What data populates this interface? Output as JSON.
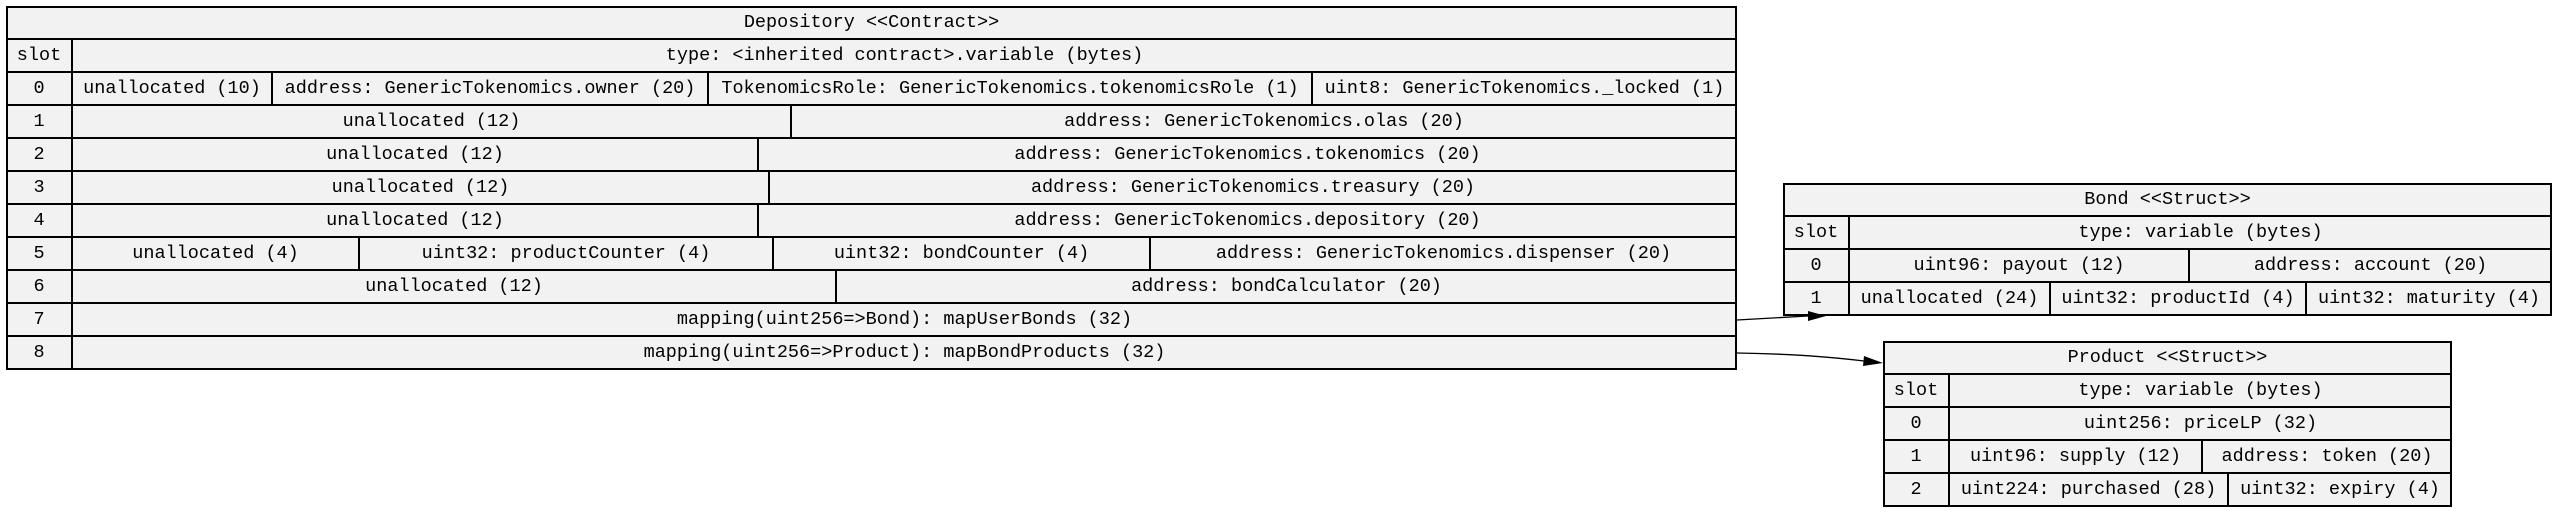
{
  "depository": {
    "title": "Depository <<Contract>>",
    "header": {
      "slot": "slot",
      "type": "type: <inherited contract>.variable (bytes)"
    },
    "rows": [
      {
        "slot": "0",
        "cells": [
          "unallocated (10)",
          "address: GenericTokenomics.owner (20)",
          "TokenomicsRole: GenericTokenomics.tokenomicsRole (1)",
          "uint8: GenericTokenomics._locked (1)"
        ]
      },
      {
        "slot": "1",
        "cells": [
          "unallocated (12)",
          "address: GenericTokenomics.olas (20)"
        ]
      },
      {
        "slot": "2",
        "cells": [
          "unallocated (12)",
          "address: GenericTokenomics.tokenomics (20)"
        ]
      },
      {
        "slot": "3",
        "cells": [
          "unallocated (12)",
          "address: GenericTokenomics.treasury (20)"
        ]
      },
      {
        "slot": "4",
        "cells": [
          "unallocated (12)",
          "address: GenericTokenomics.depository (20)"
        ]
      },
      {
        "slot": "5",
        "cells": [
          "unallocated (4)",
          "uint32: productCounter (4)",
          "uint32: bondCounter (4)",
          "address: GenericTokenomics.dispenser (20)"
        ]
      },
      {
        "slot": "6",
        "cells": [
          "unallocated (12)",
          "address: bondCalculator (20)"
        ]
      },
      {
        "slot": "7",
        "cells": [
          "mapping(uint256=>Bond): mapUserBonds (32)"
        ]
      },
      {
        "slot": "8",
        "cells": [
          "mapping(uint256=>Product): mapBondProducts (32)"
        ]
      }
    ]
  },
  "bond": {
    "title": "Bond <<Struct>>",
    "header": {
      "slot": "slot",
      "type": "type: variable (bytes)"
    },
    "rows": [
      {
        "slot": "0",
        "cells": [
          "uint96: payout (12)",
          "address: account (20)"
        ]
      },
      {
        "slot": "1",
        "cells": [
          "unallocated (24)",
          "uint32: productId (4)",
          "uint32: maturity (4)"
        ]
      }
    ]
  },
  "product": {
    "title": "Product <<Struct>>",
    "header": {
      "slot": "slot",
      "type": "type: variable (bytes)"
    },
    "rows": [
      {
        "slot": "0",
        "cells": [
          "uint256: priceLP (32)"
        ]
      },
      {
        "slot": "1",
        "cells": [
          "uint96: supply (12)",
          "address: token (20)"
        ]
      },
      {
        "slot": "2",
        "cells": [
          "uint224: purchased (28)",
          "uint32: expiry (4)"
        ]
      }
    ]
  }
}
